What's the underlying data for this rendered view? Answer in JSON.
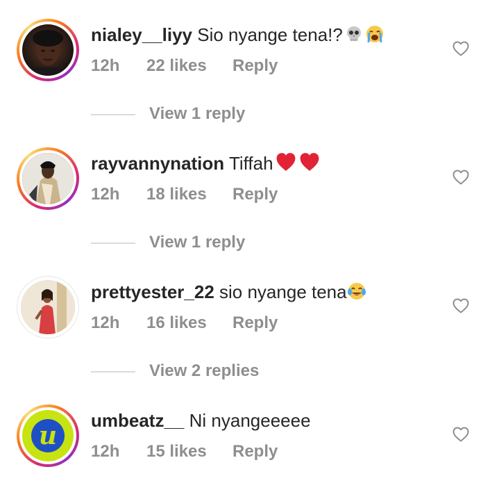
{
  "comments": [
    {
      "username": "nialey__liyy",
      "text": "Sio nyange tena!?",
      "emojis": [
        "skull-emoji",
        "loudly-crying-face-emoji"
      ],
      "time": "12h",
      "likes": "22 likes",
      "reply": "Reply",
      "view_replies": "View 1 reply",
      "story_ring": true
    },
    {
      "username": "rayvannynation",
      "text": "Tiffah",
      "emojis": [
        "red-heart-emoji",
        "red-heart-emoji"
      ],
      "time": "12h",
      "likes": "18 likes",
      "reply": "Reply",
      "view_replies": "View 1 reply",
      "story_ring": true
    },
    {
      "username": "prettyester_22",
      "text": "sio nyange tena",
      "emojis": [
        "face-with-tears-of-joy-emoji"
      ],
      "time": "12h",
      "likes": "16 likes",
      "reply": "Reply",
      "view_replies": "View 2 replies",
      "story_ring": false
    },
    {
      "username": "umbeatz__",
      "text": "Ni nyangeeeee",
      "emojis": [],
      "time": "12h",
      "likes": "15 likes",
      "reply": "Reply",
      "view_replies": "",
      "story_ring": true,
      "avatar_letter": "u"
    }
  ],
  "icons": {
    "like": "heart-outline-icon"
  },
  "colors": {
    "text": "#262626",
    "secondary": "#8e8e8e",
    "divider": "#dbdbdb",
    "heart": "#8e8e8e"
  }
}
